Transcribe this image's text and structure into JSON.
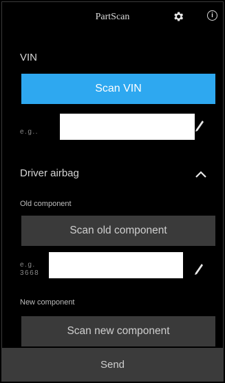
{
  "app": {
    "title": "PartScan",
    "settings_icon": "gear-icon",
    "info_icon": "info-icon",
    "info_glyph": "i"
  },
  "vin": {
    "section_label": "VIN",
    "scan_button": "Scan VIN",
    "field_placeholder": "e.g..",
    "edit_icon": "pencil-icon"
  },
  "airbag": {
    "section_label": "Driver airbag",
    "collapse_icon": "chevron-up-icon",
    "old": {
      "label": "Old component",
      "scan_button": "Scan old component",
      "placeholder_line1": "e.g.",
      "placeholder_line2": "3668",
      "edit_icon": "pencil-icon"
    },
    "new": {
      "label": "New component",
      "scan_button": "Scan new component"
    }
  },
  "footer": {
    "send_button": "Send"
  },
  "colors": {
    "accent": "#2ea8f0",
    "background": "#000000",
    "button_gray": "#3a3a3a"
  }
}
